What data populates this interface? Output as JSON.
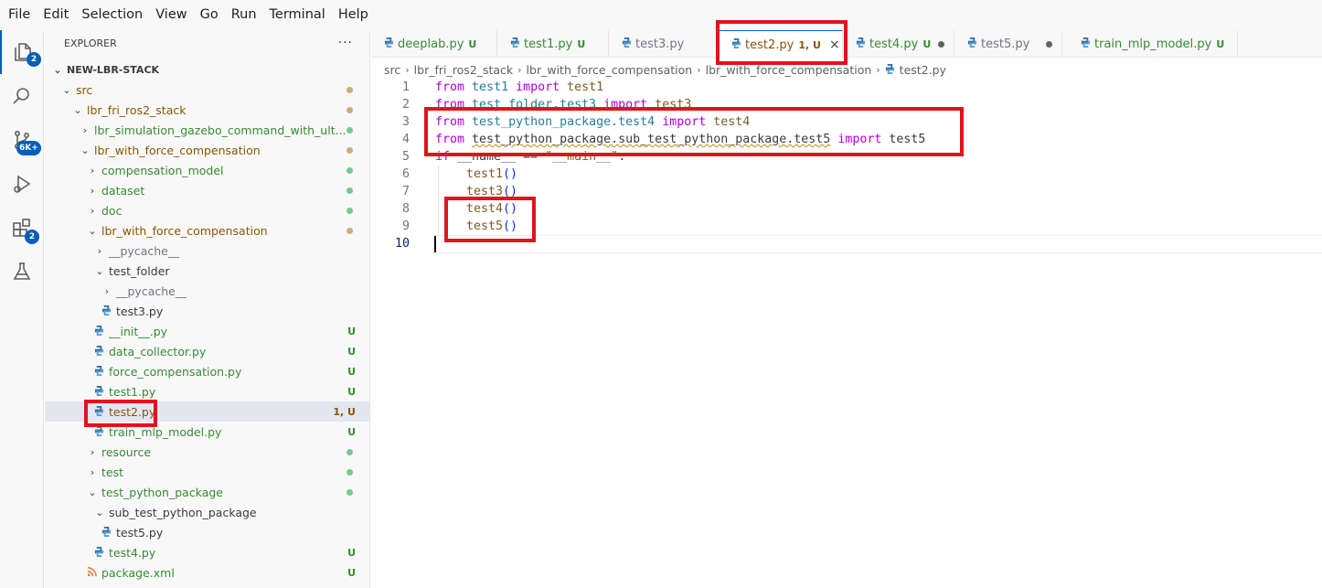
{
  "menubar": [
    "File",
    "Edit",
    "Selection",
    "View",
    "Go",
    "Run",
    "Terminal",
    "Help"
  ],
  "activity_bar": {
    "explorer_badge": "2",
    "source_control_badge": "6K+",
    "extensions_badge": "2"
  },
  "explorer": {
    "title": "EXPLORER",
    "more": "···",
    "root": "NEW-LBR-STACK",
    "items": [
      {
        "label": "src",
        "status": "",
        "color": "o"
      },
      {
        "label": "lbr_fri_ros2_stack",
        "status": "",
        "color": "o"
      },
      {
        "label": "lbr_simulation_gazebo_command_with_ult...",
        "status": "",
        "color": "g"
      },
      {
        "label": "lbr_with_force_compensation",
        "status": "",
        "color": "o"
      },
      {
        "label": "compensation_model",
        "status": "",
        "color": "g"
      },
      {
        "label": "dataset",
        "status": "",
        "color": "g"
      },
      {
        "label": "doc",
        "status": "",
        "color": "g"
      },
      {
        "label": "lbr_with_force_compensation",
        "status": "",
        "color": "o"
      },
      {
        "label": "__pycache__",
        "status": "",
        "color": "gr"
      },
      {
        "label": "test_folder",
        "status": "",
        "color": "dk"
      },
      {
        "label": "__pycache__",
        "status": "",
        "color": "gr"
      },
      {
        "label": "test3.py",
        "status": "",
        "color": "dk"
      },
      {
        "label": "__init__.py",
        "status": "U",
        "color": "g"
      },
      {
        "label": "data_collector.py",
        "status": "U",
        "color": "g"
      },
      {
        "label": "force_compensation.py",
        "status": "U",
        "color": "g"
      },
      {
        "label": "test1.py",
        "status": "U",
        "color": "g"
      },
      {
        "label": "test2.py",
        "status": "1, U",
        "color": "o"
      },
      {
        "label": "train_mlp_model.py",
        "status": "U",
        "color": "g"
      },
      {
        "label": "resource",
        "status": "",
        "color": "g"
      },
      {
        "label": "test",
        "status": "",
        "color": "g"
      },
      {
        "label": "test_python_package",
        "status": "",
        "color": "g"
      },
      {
        "label": "sub_test_python_package",
        "status": "",
        "color": "dk"
      },
      {
        "label": "test5.py",
        "status": "",
        "color": "dk"
      },
      {
        "label": "test4.py",
        "status": "U",
        "color": "g"
      },
      {
        "label": "package.xml",
        "status": "U",
        "color": "g"
      }
    ]
  },
  "tabs": [
    {
      "label": "deeplab.py",
      "status": "U"
    },
    {
      "label": "test1.py",
      "status": "U"
    },
    {
      "label": "test3.py",
      "status": ""
    },
    {
      "label": "test2.py",
      "status": "1, U",
      "close": "×"
    },
    {
      "label": "test4.py",
      "status": "U"
    },
    {
      "label": "test5.py",
      "status": ""
    },
    {
      "label": "train_mlp_model.py",
      "status": "U"
    }
  ],
  "breadcrumb": [
    "src",
    "lbr_fri_ros2_stack",
    "lbr_with_force_compensation",
    "lbr_with_force_compensation",
    "test2.py"
  ],
  "breadcrumb_sep": "›",
  "editor": {
    "line_numbers": [
      "1",
      "2",
      "3",
      "4",
      "5",
      "6",
      "7",
      "8",
      "9",
      "10"
    ],
    "l1": {
      "a": "from",
      "b": "test1",
      "c": "import",
      "d": "test1"
    },
    "l2": {
      "a": "from",
      "b": "test_folder.test3",
      "c": "import",
      "d": "test3"
    },
    "l3": {
      "a": "from",
      "b": "test_python_package.test4",
      "c": "import",
      "d": "test4"
    },
    "l4": {
      "a": "from",
      "b": "test_python_package.sub_test_python_package.test5",
      "c": "import",
      "d": "test5"
    },
    "l5": {
      "a": "if",
      "b": "__name__",
      "c": "==",
      "d": "\"__main__\"",
      "e": ":"
    },
    "l6": {
      "fn": "test1",
      "p": "()"
    },
    "l7": {
      "fn": "test3",
      "p": "()"
    },
    "l8": {
      "fn": "test4",
      "p": "()"
    },
    "l9": {
      "fn": "test5",
      "p": "()"
    }
  },
  "colors": {
    "highlight": "#e0141b",
    "accent": "#005fb8",
    "untracked": "#388a34",
    "modified": "#895503"
  }
}
